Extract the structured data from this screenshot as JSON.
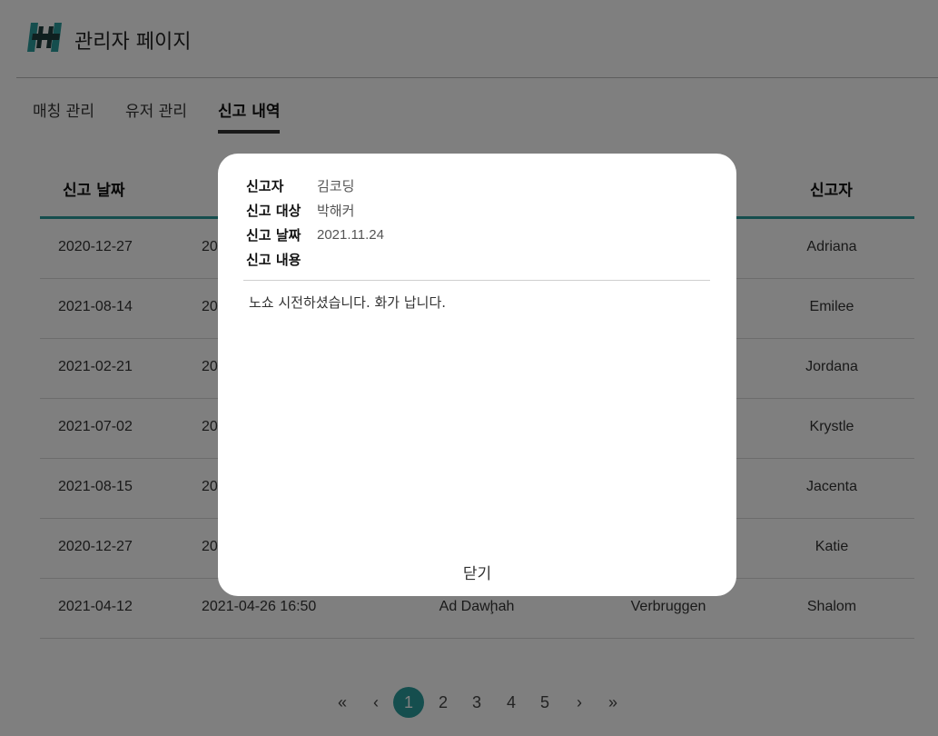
{
  "header": {
    "title": "관리자 페이지",
    "logo_icon": "barbell-h-logo",
    "accent": "#2a9d9d"
  },
  "tabs": [
    {
      "label": "매칭 관리",
      "active": false
    },
    {
      "label": "유저 관리",
      "active": false
    },
    {
      "label": "신고 내역",
      "active": true
    }
  ],
  "table": {
    "headers": [
      "신고 날짜",
      "신고자"
    ],
    "rows": [
      {
        "report_date": "2020-12-27",
        "col2": "20",
        "col3": "",
        "col4": "",
        "reporter": "Adriana"
      },
      {
        "report_date": "2021-08-14",
        "col2": "20",
        "col3": "",
        "col4": "",
        "reporter": "Emilee"
      },
      {
        "report_date": "2021-02-21",
        "col2": "20",
        "col3": "",
        "col4": "",
        "reporter": "Jordana"
      },
      {
        "report_date": "2021-07-02",
        "col2": "20",
        "col3": "",
        "col4": "",
        "reporter": "Krystle"
      },
      {
        "report_date": "2021-08-15",
        "col2": "20",
        "col3": "",
        "col4": "",
        "reporter": "Jacenta"
      },
      {
        "report_date": "2020-12-27",
        "col2": "20",
        "col3": "",
        "col4": "",
        "reporter": "Katie"
      },
      {
        "report_date": "2021-04-12",
        "col2": "2021-04-26 16:50",
        "col3": "Ad Dawḩah",
        "col4": "Verbruggen",
        "reporter": "Shalom"
      }
    ]
  },
  "pagination": {
    "first": "«",
    "prev": "‹",
    "pages": [
      "1",
      "2",
      "3",
      "4",
      "5"
    ],
    "current": "1",
    "next": "›",
    "last": "»"
  },
  "modal": {
    "reporter_label": "신고자",
    "reporter_value": "김코딩",
    "target_label": "신고 대상",
    "target_value": "박해커",
    "date_label": "신고 날짜",
    "date_value": "2021.11.24",
    "content_label": "신고 내용",
    "content_text": "노쇼 시전하셨습니다. 화가 납니다.",
    "close_label": "닫기"
  }
}
